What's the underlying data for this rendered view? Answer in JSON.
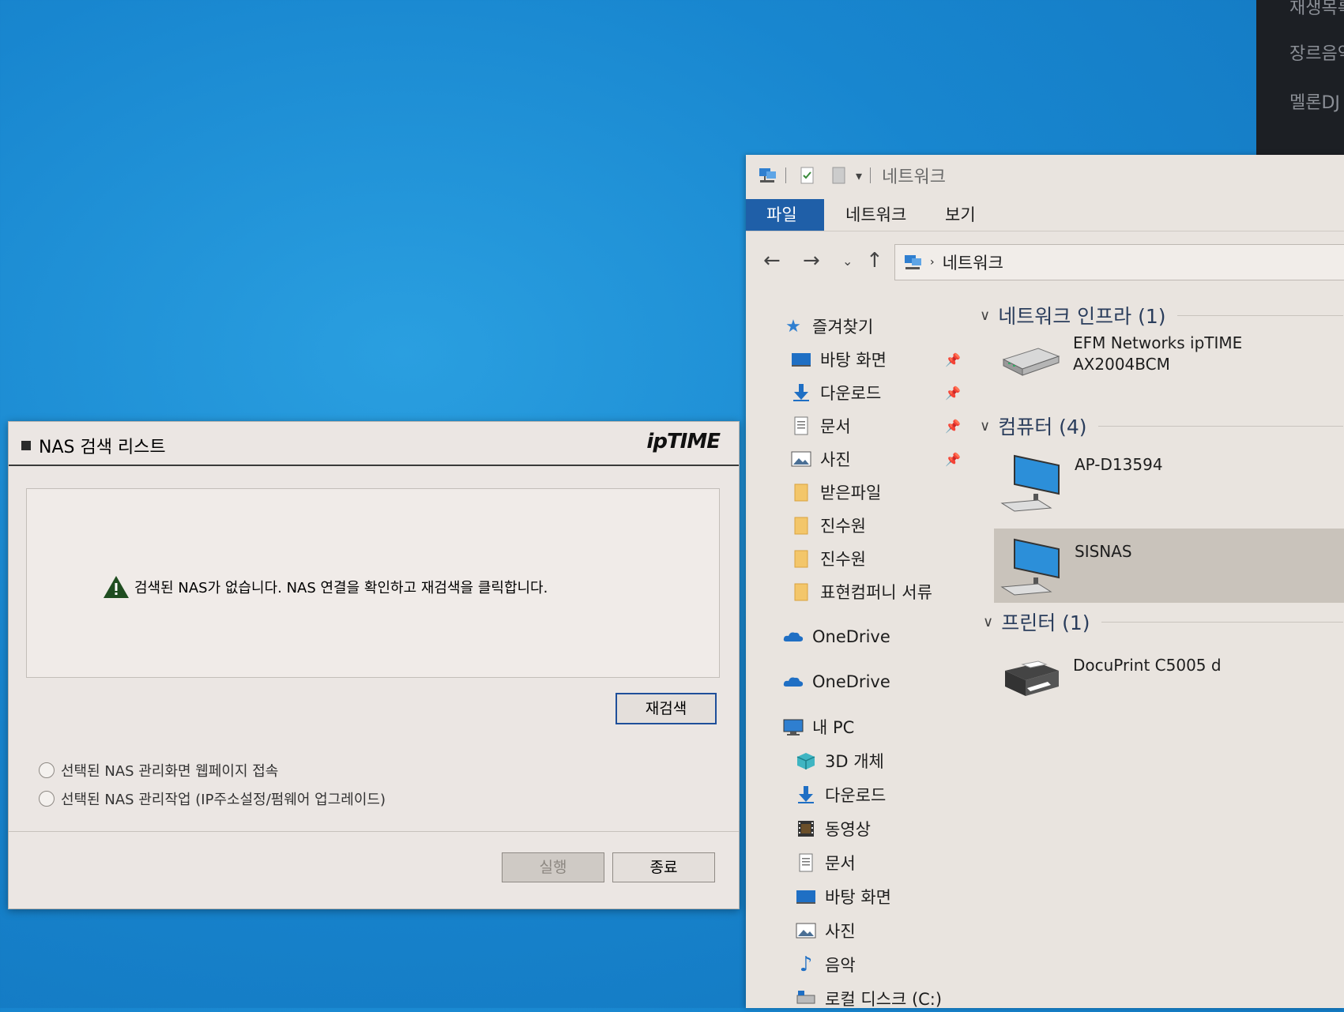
{
  "background_app": {
    "items": [
      "재생목록",
      "장르음악",
      "멜론DJ"
    ]
  },
  "explorer": {
    "title": "네트워크",
    "ribbon_tabs": [
      "파일",
      "네트워크",
      "보기"
    ],
    "address": "네트워크",
    "sidebar": {
      "quick_access": "즐겨찾기",
      "quick_items": [
        {
          "label": "바탕 화면",
          "icon": "desktop-icon",
          "pinned": true
        },
        {
          "label": "다운로드",
          "icon": "download-icon",
          "pinned": true
        },
        {
          "label": "문서",
          "icon": "document-icon",
          "pinned": true
        },
        {
          "label": "사진",
          "icon": "picture-icon",
          "pinned": true
        },
        {
          "label": "받은파일",
          "icon": "folder-icon",
          "pinned": false
        },
        {
          "label": "진수원",
          "icon": "folder-icon",
          "pinned": false
        },
        {
          "label": "진수원",
          "icon": "folder-icon",
          "pinned": false
        },
        {
          "label": "표현컴퍼니 서류",
          "icon": "folder-icon",
          "pinned": false
        }
      ],
      "onedrive_1": "OneDrive",
      "onedrive_2": "OneDrive",
      "this_pc": "내 PC",
      "pc_items": [
        {
          "label": "3D 개체",
          "icon": "3d-objects-icon"
        },
        {
          "label": "다운로드",
          "icon": "download-icon"
        },
        {
          "label": "동영상",
          "icon": "video-icon"
        },
        {
          "label": "문서",
          "icon": "document-icon"
        },
        {
          "label": "바탕 화면",
          "icon": "desktop-icon"
        },
        {
          "label": "사진",
          "icon": "picture-icon"
        },
        {
          "label": "음악",
          "icon": "music-icon"
        },
        {
          "label": "로컬 디스크 (C:)",
          "icon": "drive-icon"
        }
      ]
    },
    "groups": {
      "infra": "네트워크 인프라 (1)",
      "computers": "컴퓨터 (4)",
      "printers": "프린터 (1)"
    },
    "devices": {
      "router_line1": "EFM Networks ipTIME",
      "router_line2": "AX2004BCM",
      "pc1": "AP-D13594",
      "pc2": "SISNAS",
      "printer": "DocuPrint C5005 d"
    }
  },
  "nas_dialog": {
    "title": "NAS 검색 리스트",
    "logo": "ipTIME",
    "message": "검색된 NAS가 없습니다. NAS 연결을 확인하고 재검색을 클릭합니다.",
    "rescan": "재검색",
    "option_web": "선택된 NAS 관리화면 웹페이지 접속",
    "option_admin": "선택된 NAS 관리작업 (IP주소설정/펌웨어 업그레이드)",
    "execute": "실행",
    "close": "종료"
  },
  "colors": {
    "desktop": "#1886cf",
    "ribbon_active": "#1f5fa8",
    "window_bg": "#e9e4df"
  }
}
